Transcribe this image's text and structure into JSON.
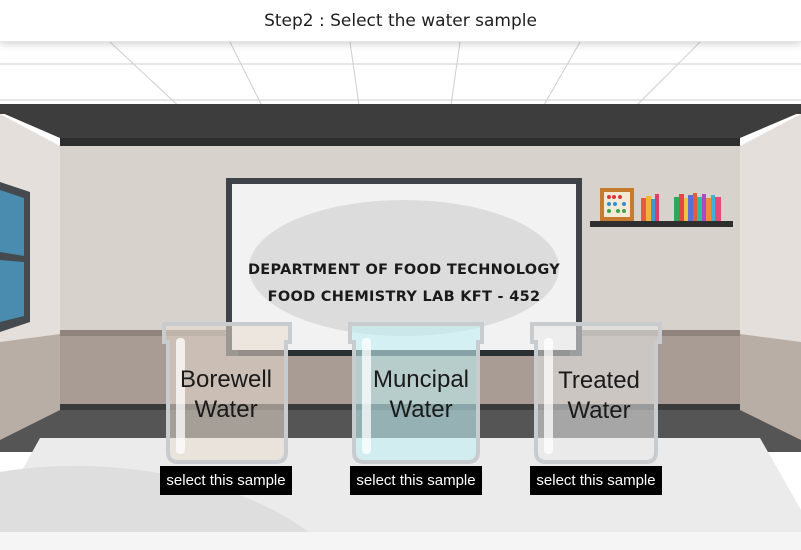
{
  "header": {
    "title": "Step2 : Select the water sample"
  },
  "board": {
    "line1": "Department of Food Technology",
    "line2": "Food Chemistry Lab KFT - 452"
  },
  "samples": [
    {
      "label_line1": "Borewell",
      "label_line2": "Water",
      "button": "select this sample",
      "liquid": "#e8ddd0"
    },
    {
      "label_line1": "Muncipal",
      "label_line2": "Water",
      "button": "select this sample",
      "liquid": "#bfeef2"
    },
    {
      "label_line1": "Treated",
      "label_line2": "Water",
      "button": "select this sample",
      "liquid": "#e9e9e9"
    }
  ],
  "colors": {
    "wall": "#d8d2cc",
    "wainscot": "#a89c94",
    "trim": "#3a3a3a",
    "table": "#ececec",
    "button_bg": "#000000"
  }
}
